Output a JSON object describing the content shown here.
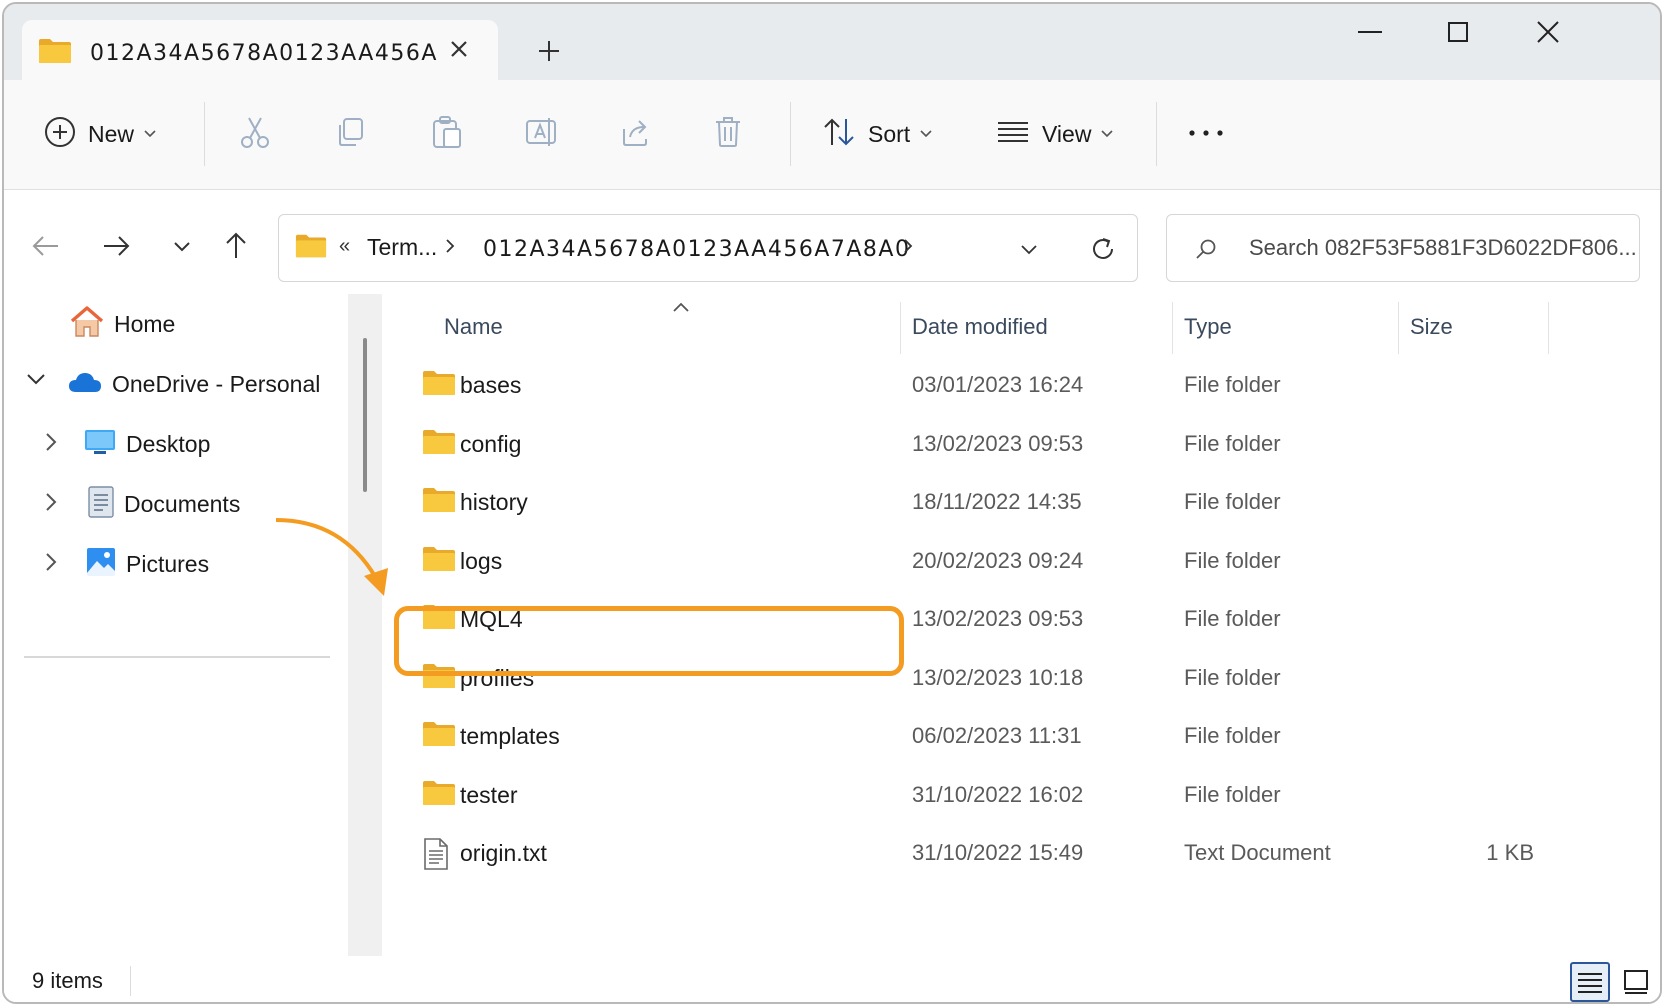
{
  "window": {
    "tab_title": "012A34A5678A0123AA456A"
  },
  "toolbar": {
    "new_label": "New",
    "sort_label": "Sort",
    "view_label": "View",
    "more_label": "···"
  },
  "address": {
    "overflow": "«",
    "crumb1": "Term...",
    "crumb2": "012A34A5678A0123AA456A7A8A0",
    "search_placeholder": "Search 082F53F5881F3D6022DF806..."
  },
  "nav": {
    "home": "Home",
    "onedrive": "OneDrive - Personal",
    "desktop": "Desktop",
    "documents": "Documents",
    "pictures": "Pictures"
  },
  "columns": {
    "name": "Name",
    "date": "Date modified",
    "type": "Type",
    "size": "Size"
  },
  "files": [
    {
      "name": "bases",
      "date": "03/01/2023 16:24",
      "type": "File folder",
      "size": "",
      "icon": "folder-icon"
    },
    {
      "name": "config",
      "date": "13/02/2023 09:53",
      "type": "File folder",
      "size": "",
      "icon": "folder-icon"
    },
    {
      "name": "history",
      "date": "18/11/2022 14:35",
      "type": "File folder",
      "size": "",
      "icon": "folder-icon"
    },
    {
      "name": "logs",
      "date": "20/02/2023 09:24",
      "type": "File folder",
      "size": "",
      "icon": "folder-icon"
    },
    {
      "name": "MQL4",
      "date": "13/02/2023 09:53",
      "type": "File folder",
      "size": "",
      "icon": "folder-icon"
    },
    {
      "name": "profiles",
      "date": "13/02/2023 10:18",
      "type": "File folder",
      "size": "",
      "icon": "folder-icon"
    },
    {
      "name": "templates",
      "date": "06/02/2023 11:31",
      "type": "File folder",
      "size": "",
      "icon": "folder-icon"
    },
    {
      "name": "tester",
      "date": "31/10/2022 16:02",
      "type": "File folder",
      "size": "",
      "icon": "folder-icon"
    },
    {
      "name": "origin.txt",
      "date": "31/10/2022 15:49",
      "type": "Text Document",
      "size": "1 KB",
      "icon": "text-file-icon"
    }
  ],
  "status": {
    "item_count": "9 items"
  },
  "colors": {
    "highlight": "#f39c21",
    "folder": "#f8c93e",
    "accent": "#2b579a"
  }
}
